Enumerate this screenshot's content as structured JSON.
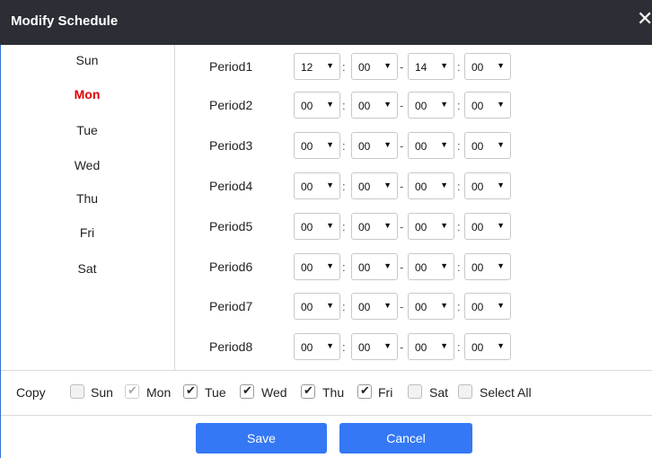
{
  "dialog": {
    "title": "Modify Schedule",
    "close_label": "✕"
  },
  "days": [
    "Sun",
    "Mon",
    "Tue",
    "Wed",
    "Thu",
    "Fri",
    "Sat"
  ],
  "selected_day": "Mon",
  "periods": [
    {
      "label": "Period1",
      "start_hour": "12",
      "start_min": "00",
      "end_hour": "14",
      "end_min": "00"
    },
    {
      "label": "Period2",
      "start_hour": "00",
      "start_min": "00",
      "end_hour": "00",
      "end_min": "00"
    },
    {
      "label": "Period3",
      "start_hour": "00",
      "start_min": "00",
      "end_hour": "00",
      "end_min": "00"
    },
    {
      "label": "Period4",
      "start_hour": "00",
      "start_min": "00",
      "end_hour": "00",
      "end_min": "00"
    },
    {
      "label": "Period5",
      "start_hour": "00",
      "start_min": "00",
      "end_hour": "00",
      "end_min": "00"
    },
    {
      "label": "Period6",
      "start_hour": "00",
      "start_min": "00",
      "end_hour": "00",
      "end_min": "00"
    },
    {
      "label": "Period7",
      "start_hour": "00",
      "start_min": "00",
      "end_hour": "00",
      "end_min": "00"
    },
    {
      "label": "Period8",
      "start_hour": "00",
      "start_min": "00",
      "end_hour": "00",
      "end_min": "00"
    }
  ],
  "separators": {
    "time": ":",
    "range": "-"
  },
  "copy": {
    "label": "Copy",
    "options": [
      {
        "label": "Sun",
        "checked": false,
        "disabled": false
      },
      {
        "label": "Mon",
        "checked": true,
        "disabled": true
      },
      {
        "label": "Tue",
        "checked": true,
        "disabled": false
      },
      {
        "label": "Wed",
        "checked": true,
        "disabled": false
      },
      {
        "label": "Thu",
        "checked": true,
        "disabled": false
      },
      {
        "label": "Fri",
        "checked": true,
        "disabled": false
      },
      {
        "label": "Sat",
        "checked": false,
        "disabled": false
      },
      {
        "label": "Select All",
        "checked": false,
        "disabled": false
      }
    ]
  },
  "buttons": {
    "save": "Save",
    "cancel": "Cancel"
  },
  "colors": {
    "titlebar": "#2c2e35",
    "accent": "#3478f6",
    "selected_day": "#e00000"
  }
}
